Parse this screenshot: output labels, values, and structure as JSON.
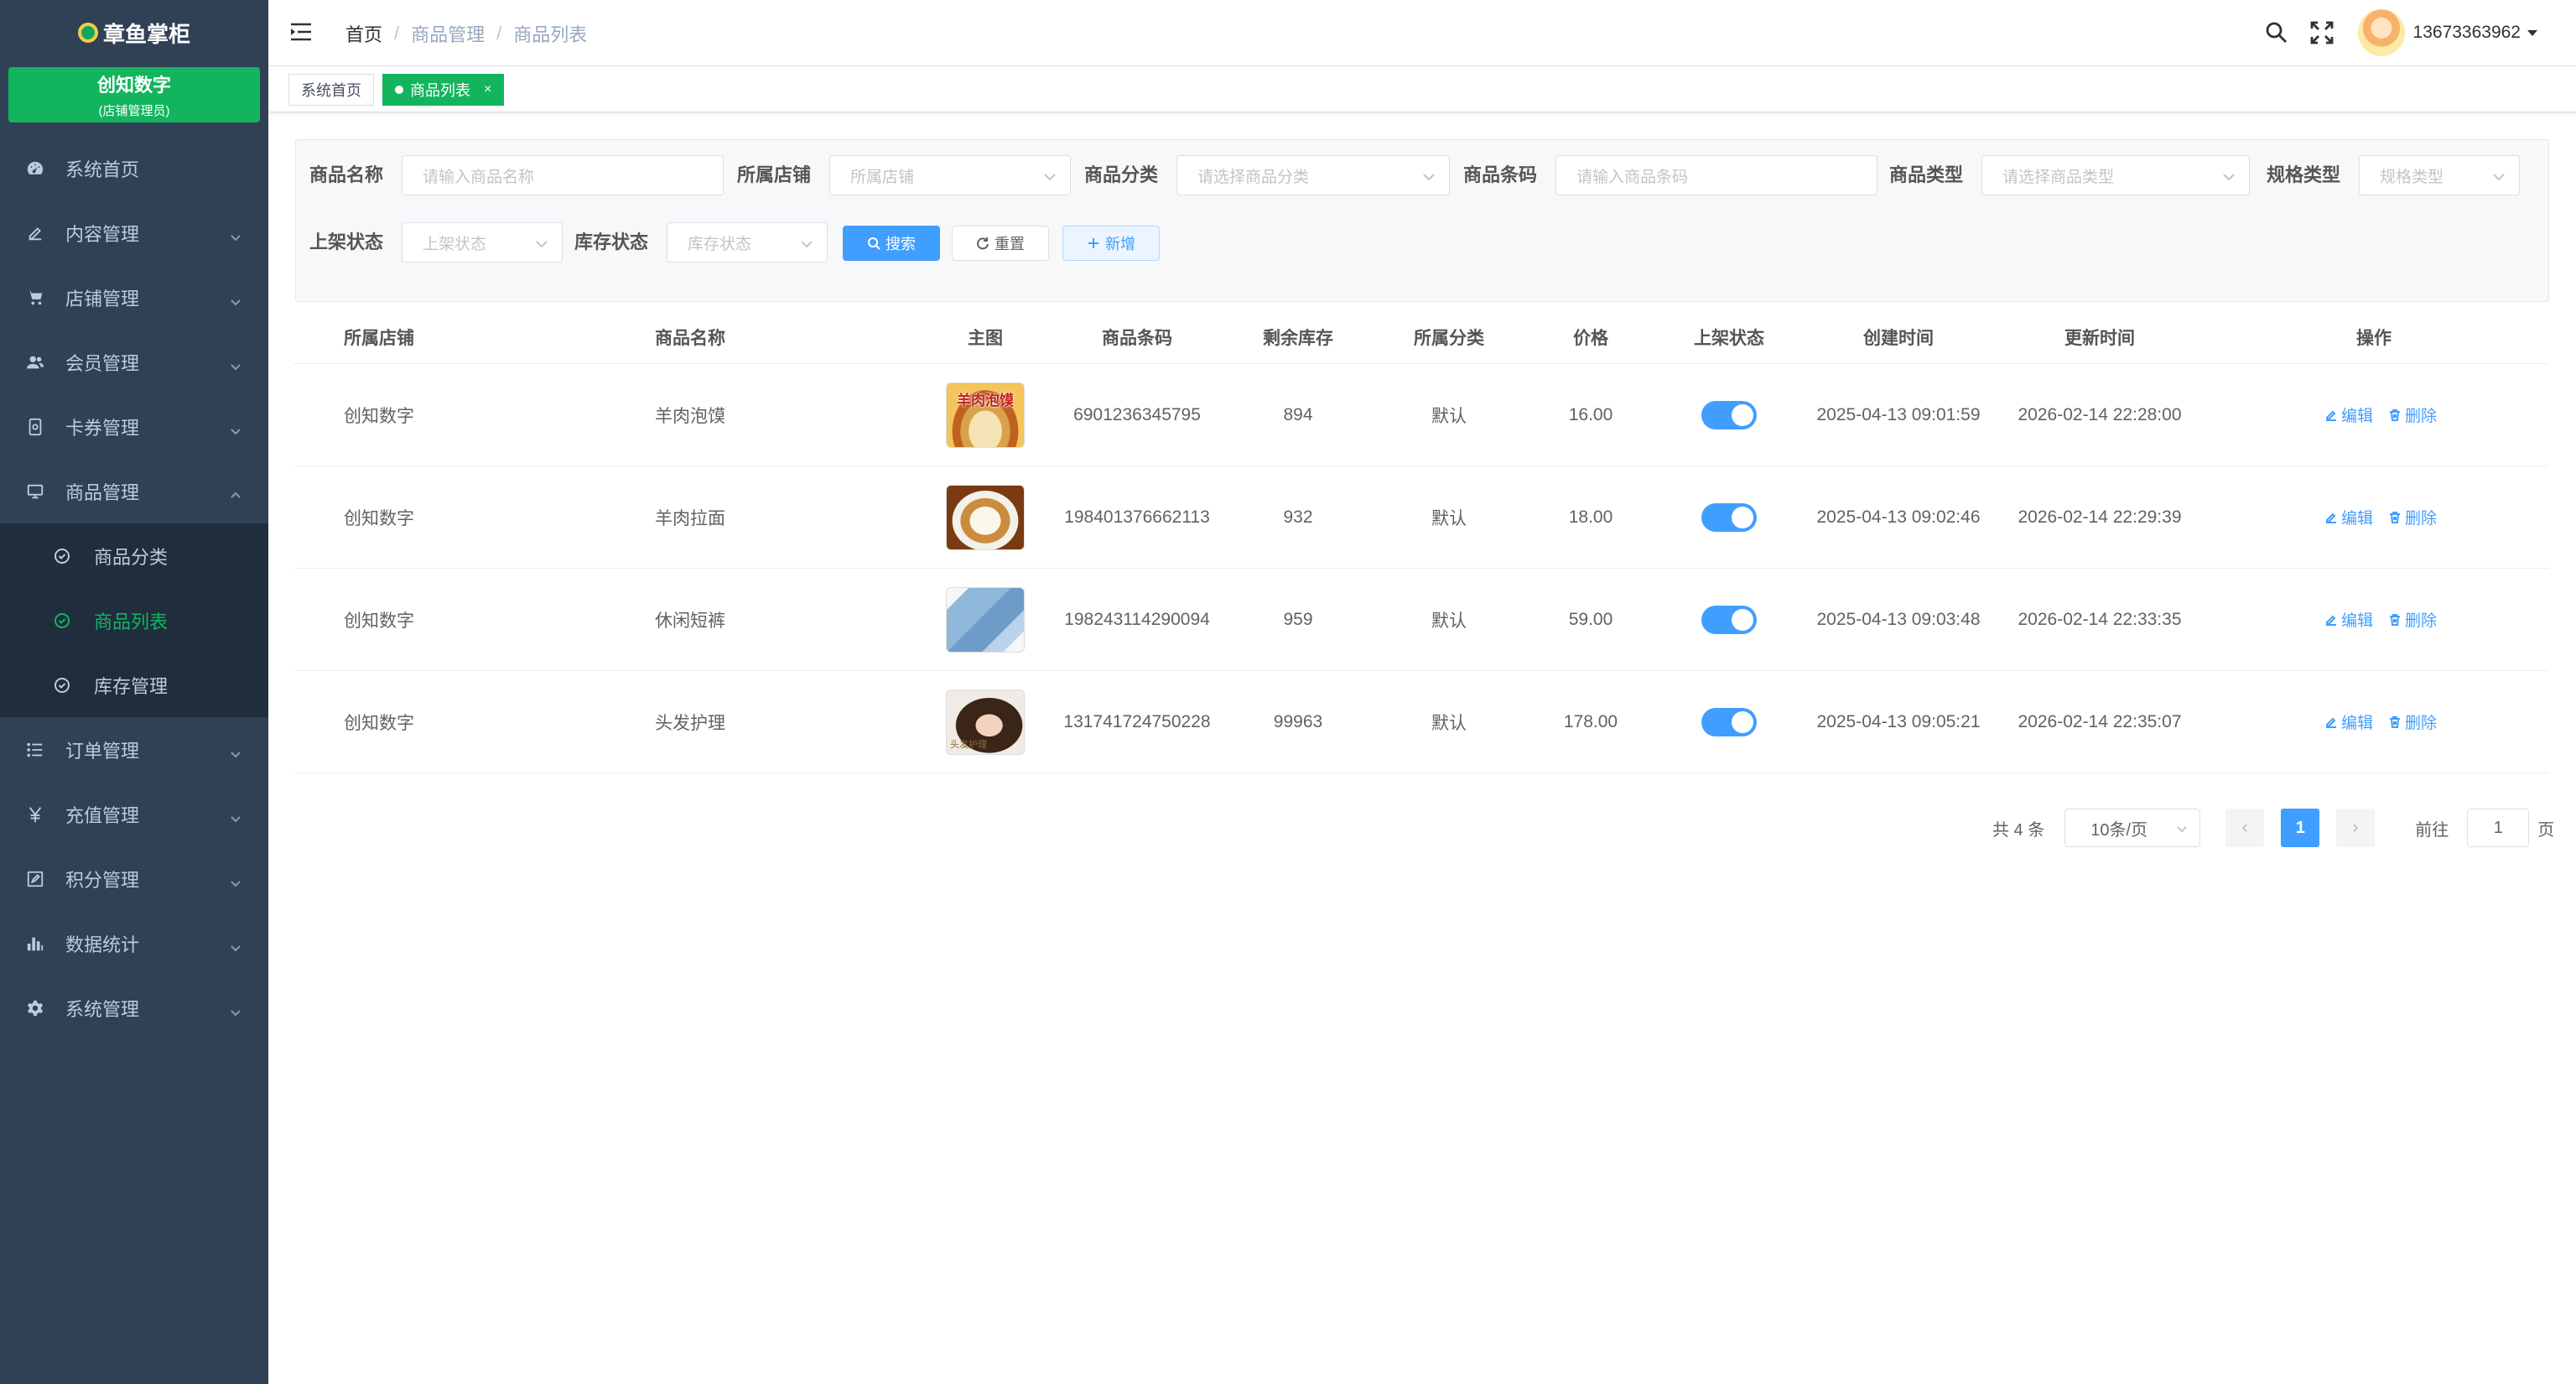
{
  "app": {
    "name": "章鱼掌柜"
  },
  "store": {
    "name": "创知数字",
    "role": "(店铺管理员)"
  },
  "menu": [
    {
      "label": "系统首页",
      "icon": "dashboard-icon"
    },
    {
      "label": "内容管理",
      "icon": "edit-icon"
    },
    {
      "label": "店铺管理",
      "icon": "cart-icon"
    },
    {
      "label": "会员管理",
      "icon": "users-icon"
    },
    {
      "label": "卡券管理",
      "icon": "card-icon"
    },
    {
      "label": "商品管理",
      "icon": "monitor-icon",
      "expanded": true
    }
  ],
  "submenu": [
    {
      "label": "商品分类",
      "icon": "circle-check-icon"
    },
    {
      "label": "商品列表",
      "icon": "circle-check-icon",
      "active": true
    },
    {
      "label": "库存管理",
      "icon": "circle-check-icon"
    }
  ],
  "menu_after": [
    {
      "label": "订单管理",
      "icon": "list-icon"
    },
    {
      "label": "充值管理",
      "icon": "yen-icon"
    },
    {
      "label": "积分管理",
      "icon": "edit-square-icon"
    },
    {
      "label": "数据统计",
      "icon": "bar-chart-icon"
    },
    {
      "label": "系统管理",
      "icon": "gear-icon"
    }
  ],
  "breadcrumb": [
    "首页",
    "商品管理",
    "商品列表"
  ],
  "breadcrumb_sep": "/",
  "user": {
    "phone": "13673363962"
  },
  "tags": [
    {
      "label": "系统首页",
      "active": false
    },
    {
      "label": "商品列表",
      "active": true,
      "close": "×"
    }
  ],
  "filters": {
    "name": {
      "label": "商品名称",
      "placeholder": "请输入商品名称"
    },
    "shop": {
      "label": "所属店铺",
      "placeholder": "所属店铺"
    },
    "category": {
      "label": "商品分类",
      "placeholder": "请选择商品分类"
    },
    "barcode": {
      "label": "商品条码",
      "placeholder": "请输入商品条码"
    },
    "type": {
      "label": "商品类型",
      "placeholder": "请选择商品类型"
    },
    "spec": {
      "label": "规格类型",
      "placeholder": "规格类型"
    },
    "shelf": {
      "label": "上架状态",
      "placeholder": "上架状态"
    },
    "stock": {
      "label": "库存状态",
      "placeholder": "库存状态"
    }
  },
  "buttons": {
    "search": "搜索",
    "reset": "重置",
    "add": "新增"
  },
  "table": {
    "columns": [
      "所属店铺",
      "商品名称",
      "主图",
      "商品条码",
      "剩余库存",
      "所属分类",
      "价格",
      "上架状态",
      "创建时间",
      "更新时间",
      "操作"
    ],
    "rows": [
      {
        "shop": "创知数字",
        "name": "羊肉泡馍",
        "img_text": "羊肉泡馍",
        "barcode": "6901236345795",
        "stock": "894",
        "category": "默认",
        "price": "16.00",
        "on_shelf": true,
        "created": "2025-04-13 09:01:59",
        "updated": "2026-02-14 22:28:00"
      },
      {
        "shop": "创知数字",
        "name": "羊肉拉面",
        "img_text": "",
        "barcode": "198401376662113",
        "stock": "932",
        "category": "默认",
        "price": "18.00",
        "on_shelf": true,
        "created": "2025-04-13 09:02:46",
        "updated": "2026-02-14 22:29:39"
      },
      {
        "shop": "创知数字",
        "name": "休闲短裤",
        "img_text": "",
        "barcode": "198243114290094",
        "stock": "959",
        "category": "默认",
        "price": "59.00",
        "on_shelf": true,
        "created": "2025-04-13 09:03:48",
        "updated": "2026-02-14 22:33:35"
      },
      {
        "shop": "创知数字",
        "name": "头发护理",
        "img_text": "头发护理",
        "barcode": "131741724750228",
        "stock": "99963",
        "category": "默认",
        "price": "178.00",
        "on_shelf": true,
        "created": "2025-04-13 09:05:21",
        "updated": "2026-02-14 22:35:07"
      }
    ],
    "actions": {
      "edit": "编辑",
      "delete": "删除"
    }
  },
  "pagination": {
    "total": "共 4 条",
    "page_size": "10条/页",
    "current": "1",
    "goto_prefix": "前往",
    "goto_value": "1",
    "goto_suffix": "页"
  },
  "colors": {
    "sidebar": "#304156",
    "submenu": "#1f2d3d",
    "brand_green": "#13b45e",
    "primary": "#409eff"
  }
}
